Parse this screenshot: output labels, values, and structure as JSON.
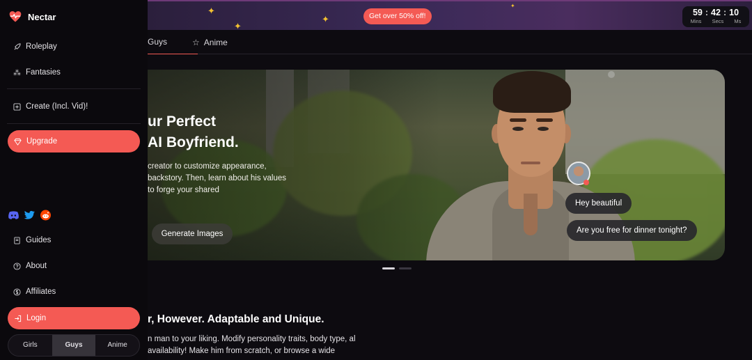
{
  "brand": {
    "name": "Nectar"
  },
  "sidebar": {
    "nav_top": [
      {
        "label": "Roleplay",
        "icon": "rocket-icon"
      },
      {
        "label": "Fantasies",
        "icon": "sparkles-icon"
      }
    ],
    "create": {
      "label": "Create (Incl. Vid)!",
      "icon": "plus-square-icon"
    },
    "upgrade": {
      "label": "Upgrade",
      "icon": "gem-icon"
    },
    "socials": [
      "discord-icon",
      "twitter-icon",
      "reddit-icon"
    ],
    "nav_bottom": [
      {
        "label": "Guides",
        "icon": "book-icon"
      },
      {
        "label": "About",
        "icon": "question-circle-icon"
      },
      {
        "label": "Affiliates",
        "icon": "dollar-circle-icon"
      }
    ],
    "login": {
      "label": "Login",
      "icon": "login-arrow-icon"
    },
    "segment": {
      "options": [
        "Girls",
        "Guys",
        "Anime"
      ],
      "selected": "Guys"
    }
  },
  "promo": {
    "cta": "Get over 50% off!",
    "timer": {
      "minutes": "59",
      "seconds": "42",
      "ms": "10",
      "sep": ":",
      "units": [
        "Mins",
        "Secs",
        "Ms"
      ]
    }
  },
  "tabs": [
    {
      "label": "Guys",
      "active": true
    },
    {
      "label": "Anime",
      "icon": "star-outline-icon",
      "active": false
    }
  ],
  "hero": {
    "title_line1": "ur Perfect",
    "title_line2": "AI Boyfriend.",
    "description": "creator to customize appearance, backstory. Then, learn about his values to forge your shared",
    "button": "Generate Images",
    "chat": [
      "Hey beautiful",
      "Are you free for dinner tonight?"
    ]
  },
  "carousel": {
    "slides": 2,
    "active": 0
  },
  "section": {
    "title": "r, However. Adaptable and Unique.",
    "description": "n man to your liking. Modify personality traits, body type, al availability! Make him from scratch, or browse a wide"
  },
  "colors": {
    "accent": "#f45a54",
    "background": "#0d0b10",
    "sidebar": "#0b090d",
    "star": "#f3c131"
  }
}
